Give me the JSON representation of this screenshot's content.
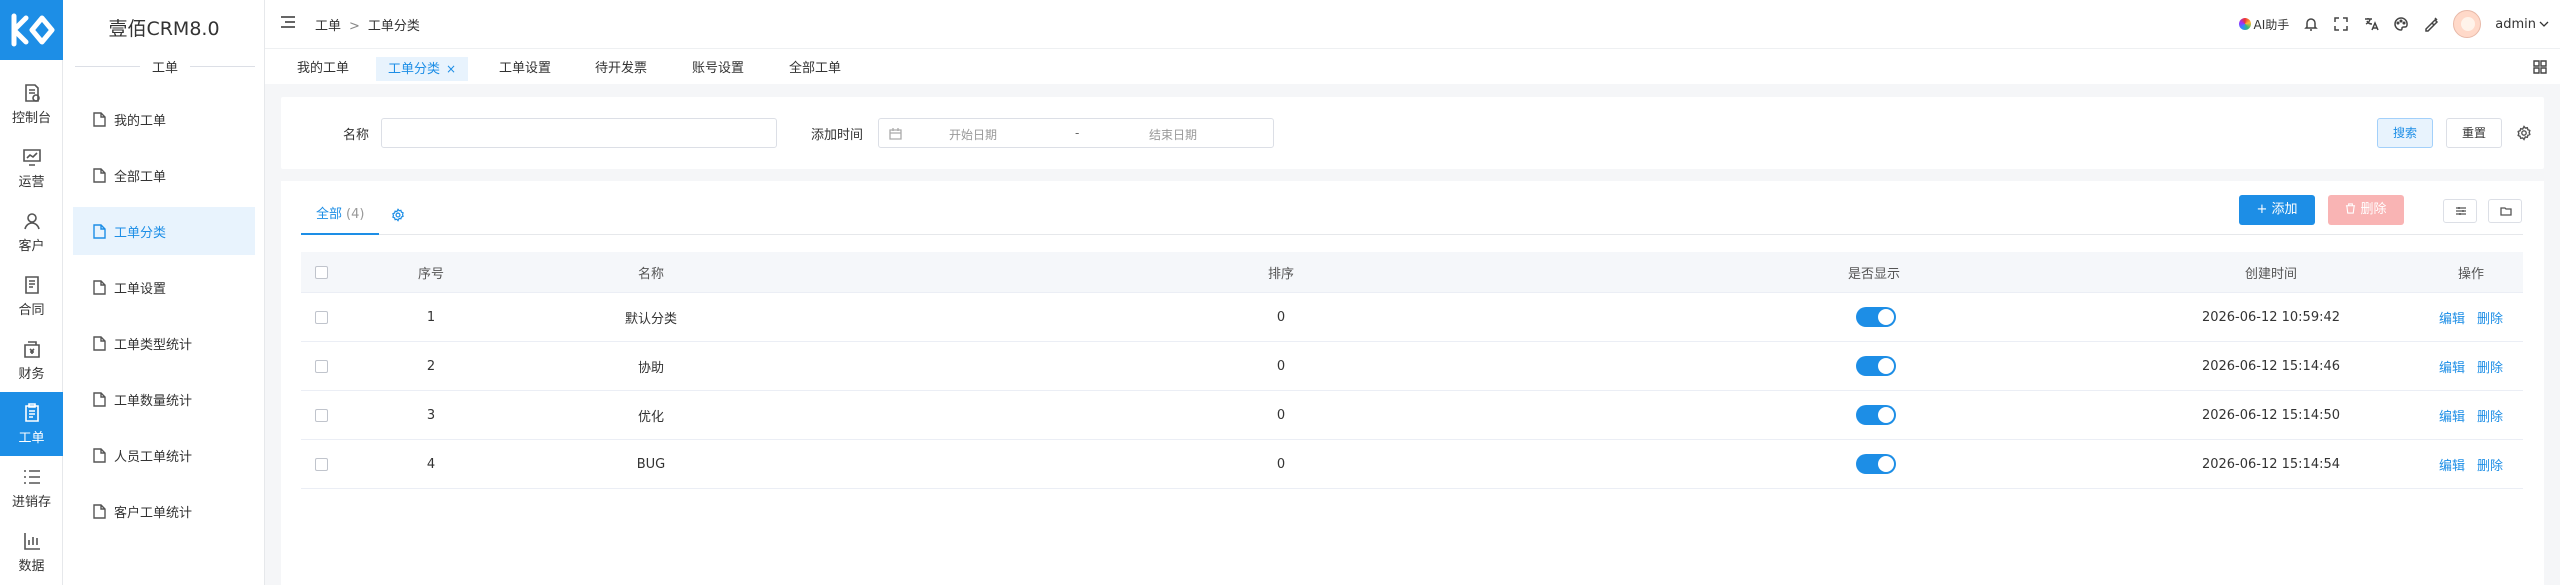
{
  "brand": {
    "title": "壹佰CRM8.0"
  },
  "rail": {
    "items": [
      {
        "label": "控制台",
        "icon": "dashboard-doc-icon"
      },
      {
        "label": "运营",
        "icon": "chart-monitor-icon"
      },
      {
        "label": "客户",
        "icon": "person-icon"
      },
      {
        "label": "合同",
        "icon": "contract-icon"
      },
      {
        "label": "财务",
        "icon": "finance-icon"
      },
      {
        "label": "工单",
        "icon": "workorder-icon",
        "active": true
      },
      {
        "label": "进销存",
        "icon": "list-icon"
      },
      {
        "label": "数据",
        "icon": "bar-chart-icon"
      }
    ]
  },
  "submenu": {
    "section": "工单",
    "items": [
      {
        "label": "我的工单"
      },
      {
        "label": "全部工单"
      },
      {
        "label": "工单分类",
        "active": true
      },
      {
        "label": "工单设置"
      },
      {
        "label": "工单类型统计"
      },
      {
        "label": "工单数量统计"
      },
      {
        "label": "人员工单统计"
      },
      {
        "label": "客户工单统计"
      }
    ]
  },
  "topbar": {
    "breadcrumb": [
      "工单",
      "工单分类"
    ],
    "breadcrumb_sep": ">",
    "ai_label": "AI助手",
    "user": "admin"
  },
  "tabs": [
    {
      "label": "我的工单"
    },
    {
      "label": "工单分类",
      "active": true,
      "close": "×"
    },
    {
      "label": "工单设置"
    },
    {
      "label": "待开发票"
    },
    {
      "label": "账号设置"
    },
    {
      "label": "全部工单"
    }
  ],
  "filter": {
    "name_label": "名称",
    "name_value": "",
    "time_label": "添加时间",
    "start_placeholder": "开始日期",
    "range_sep": "-",
    "end_placeholder": "结束日期",
    "search_label": "搜索",
    "reset_label": "重置"
  },
  "list": {
    "tab_label": "全部",
    "tab_count": "(4)",
    "add_label": "+ 添加",
    "delete_label": "删除",
    "columns": [
      "序号",
      "名称",
      "排序",
      "是否显示",
      "创建时间",
      "操作"
    ],
    "rows": [
      {
        "no": "1",
        "name": "默认分类",
        "sort": "0",
        "visible": true,
        "created": "2026-06-12 10:59:42"
      },
      {
        "no": "2",
        "name": "协助",
        "sort": "0",
        "visible": true,
        "created": "2026-06-12 15:14:46"
      },
      {
        "no": "3",
        "name": "优化",
        "sort": "0",
        "visible": true,
        "created": "2026-06-12 15:14:50"
      },
      {
        "no": "4",
        "name": "BUG",
        "sort": "0",
        "visible": true,
        "created": "2026-06-12 15:14:54"
      }
    ],
    "edit_label": "编辑",
    "remove_label": "删除"
  },
  "colors": {
    "accent": "#1d8ee6",
    "danger_disabled": "#f9b4b4",
    "active_bg": "#e8f3fd"
  }
}
